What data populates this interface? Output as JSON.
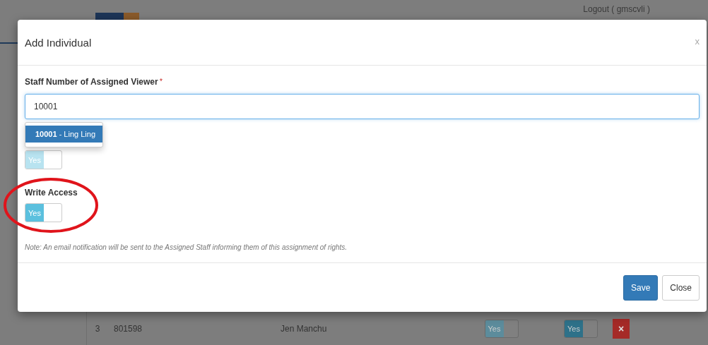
{
  "background_page": {
    "logout_link": "Logout ( gmscvli )",
    "table_row": {
      "index": "3",
      "staff_number": "801598",
      "name": "Jen Manchu",
      "read_toggle": {
        "label": "Yes",
        "on": true,
        "disabled": true
      },
      "write_toggle": {
        "label": "Yes",
        "on": true,
        "disabled": false
      },
      "delete_button": "×"
    }
  },
  "modal": {
    "title": "Add Individual",
    "close": "x",
    "staff_field": {
      "label": "Staff Number of Assigned Viewer",
      "required_mark": "*",
      "value": "10001"
    },
    "suggestions": [
      {
        "number": "10001",
        "name": " - Ling Ling",
        "selected": true
      }
    ],
    "toggles": [
      {
        "text": "Yes",
        "on": true,
        "disabled": true
      },
      {
        "label": "Write Access",
        "text": "Yes",
        "on": true,
        "disabled": false
      }
    ],
    "note": "Note: An email notification will be sent to the Assigned Staff informing them of this assignment of rights.",
    "buttons": [
      {
        "label": "Save",
        "kind": "primary"
      },
      {
        "label": "Close",
        "kind": "default"
      }
    ]
  }
}
